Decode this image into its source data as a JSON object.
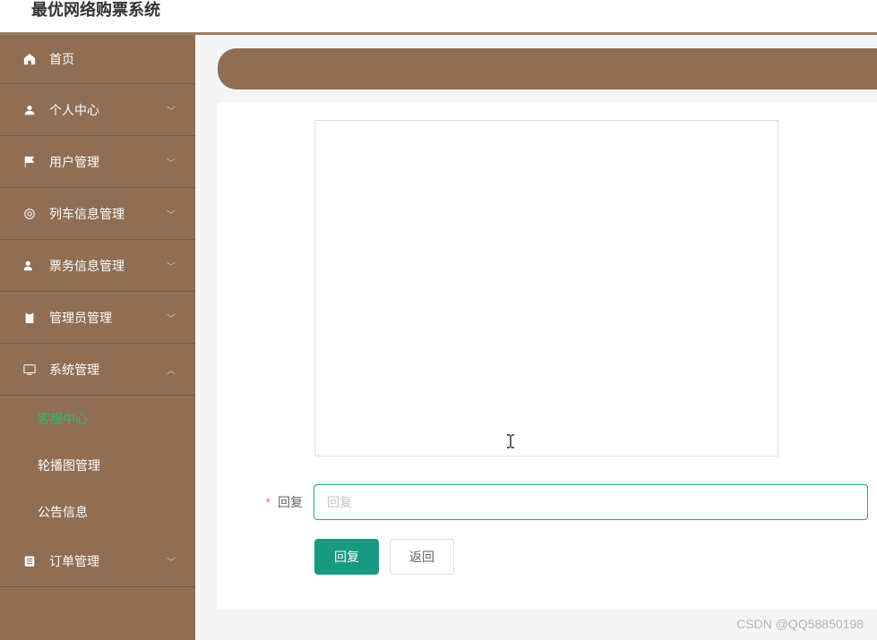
{
  "header": {
    "title": "最优网络购票系统"
  },
  "sidebar": {
    "home": {
      "label": "首页"
    },
    "items": [
      {
        "label": "个人中心",
        "icon": "user",
        "expanded": false
      },
      {
        "label": "用户管理",
        "icon": "flag",
        "expanded": false
      },
      {
        "label": "列车信息管理",
        "icon": "train",
        "expanded": false
      },
      {
        "label": "票务信息管理",
        "icon": "ticket",
        "expanded": false
      },
      {
        "label": "管理员管理",
        "icon": "clipboard",
        "expanded": false
      },
      {
        "label": "系统管理",
        "icon": "monitor",
        "expanded": true,
        "subs": [
          {
            "label": "客服中心",
            "active": true
          },
          {
            "label": "轮播图管理",
            "active": false
          },
          {
            "label": "公告信息",
            "active": false
          }
        ]
      },
      {
        "label": "订单管理",
        "icon": "list",
        "expanded": false
      }
    ]
  },
  "form": {
    "reply": {
      "label": "回复",
      "placeholder": "回复",
      "required": true,
      "value": ""
    },
    "buttons": {
      "submit": "回复",
      "back": "返回"
    }
  },
  "watermark": "CSDN @QQ58850198"
}
